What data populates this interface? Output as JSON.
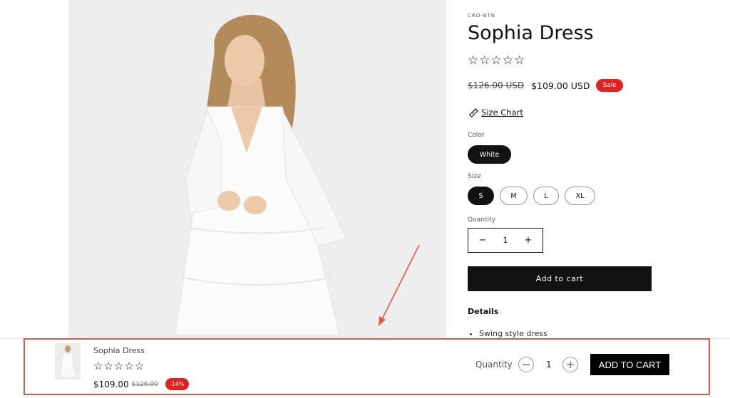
{
  "product": {
    "vendor": "CRO-BTN",
    "title": "Sophia Dress",
    "rating_stars": "☆☆☆☆☆",
    "price_old": "$126.00 USD",
    "price_new": "$109.00 USD",
    "sale_badge": "Sale",
    "size_chart_label": "Size Chart",
    "color_label": "Color",
    "colors": [
      {
        "label": "White",
        "selected": true
      }
    ],
    "size_label": "Size",
    "sizes": [
      {
        "label": "S",
        "selected": true
      },
      {
        "label": "M",
        "selected": false
      },
      {
        "label": "L",
        "selected": false
      },
      {
        "label": "XL",
        "selected": false
      }
    ],
    "quantity_label": "Quantity",
    "quantity_value": "1",
    "minus_symbol": "−",
    "plus_symbol": "+",
    "add_to_cart_label": "Add to cart",
    "details_heading": "Details",
    "details_items": [
      "Swing style dress"
    ]
  },
  "sticky_bar": {
    "name": "Sophia Dress",
    "rating_stars": "☆☆☆☆☆",
    "price": "$109.00",
    "price_old": "$126.00",
    "discount_badge": "-14%",
    "quantity_label": "Quantity",
    "quantity_value": "1",
    "minus_symbol": "−",
    "plus_symbol": "+",
    "add_to_cart_label": "ADD TO CART"
  },
  "colors": {
    "accent": "#121212",
    "sale": "#e22120",
    "highlight": "#e4574d"
  }
}
